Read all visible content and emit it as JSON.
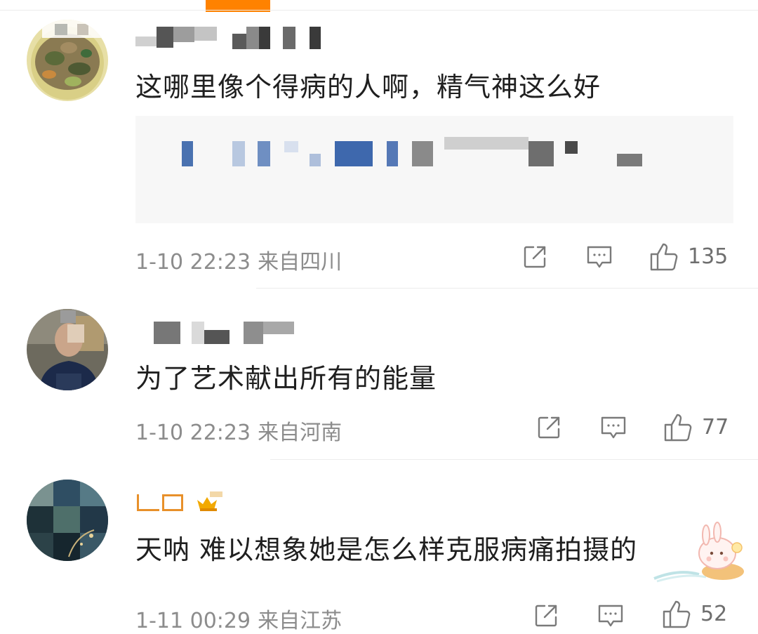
{
  "comments": [
    {
      "text": "这哪里像个得病的人啊，精气神这么好",
      "time": "1-10 22:23",
      "location": "来自四川",
      "likes": "135",
      "icons": [
        "share-icon",
        "comment-icon",
        "like-icon"
      ]
    },
    {
      "text": "为了艺术献出所有的能量",
      "time": "1-10 22:23",
      "location": "来自河南",
      "likes": "77",
      "icons": [
        "share-icon",
        "comment-icon",
        "like-icon"
      ]
    },
    {
      "text": "天呐 难以想象她是怎么样克服病痛拍摄的",
      "time": "1-11 00:29",
      "location": "来自江苏",
      "likes": "52",
      "icons": [
        "share-icon",
        "comment-icon",
        "like-icon"
      ]
    }
  ],
  "colors": {
    "accent": "#ff8200",
    "meta": "#8c8c8c",
    "text": "#1f1f1f",
    "vip_gold": "#f2a900"
  }
}
